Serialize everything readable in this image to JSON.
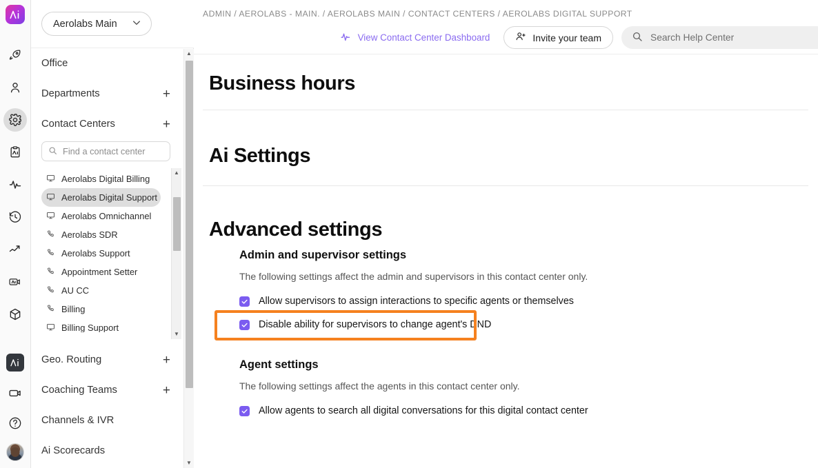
{
  "rail": {
    "logo_name": "Ai",
    "icons": [
      {
        "name": "rocket-icon",
        "label": "Getting started"
      },
      {
        "name": "user-icon",
        "label": "Users"
      },
      {
        "name": "gear-icon",
        "label": "Settings",
        "active": true
      },
      {
        "name": "clipboard-ai-icon",
        "label": "Ai forms"
      },
      {
        "name": "activity-pulse-icon",
        "label": "Live activity"
      },
      {
        "name": "history-clock-icon",
        "label": "History"
      },
      {
        "name": "trend-arrow-icon",
        "label": "Analytics"
      },
      {
        "name": "ai-camera-icon",
        "label": "Recordings"
      },
      {
        "name": "cube-icon",
        "label": "Integrations"
      }
    ],
    "bottom_icons": [
      {
        "name": "ai-app-icon",
        "label": "Ai app"
      },
      {
        "name": "video-camera-icon",
        "label": "Video"
      },
      {
        "name": "help-circle-icon",
        "label": "Help"
      },
      {
        "name": "avatar",
        "label": "Account"
      }
    ]
  },
  "sidebar": {
    "org_switcher": {
      "value": "Aerolabs Main",
      "chevron": "chevron-down-icon"
    },
    "nav": [
      {
        "label": "Office",
        "has_add": false
      },
      {
        "label": "Departments",
        "has_add": true
      },
      {
        "label": "Contact Centers",
        "has_add": true
      }
    ],
    "nav_bottom": [
      {
        "label": "Geo. Routing",
        "has_add": true
      },
      {
        "label": "Coaching Teams",
        "has_add": true
      },
      {
        "label": "Channels & IVR",
        "has_add": false
      },
      {
        "label": "Ai Scorecards",
        "has_add": false
      }
    ],
    "contact_center_search": {
      "placeholder": "Find a contact center",
      "value": ""
    },
    "contact_centers": [
      {
        "label": "Aerolabs Digital Billing",
        "icon": "monitor-icon",
        "selected": false
      },
      {
        "label": "Aerolabs Digital Support",
        "icon": "monitor-icon",
        "selected": true
      },
      {
        "label": "Aerolabs Omnichannel",
        "icon": "monitor-icon",
        "selected": false
      },
      {
        "label": "Aerolabs SDR",
        "icon": "phone-icon",
        "selected": false
      },
      {
        "label": "Aerolabs Support",
        "icon": "phone-icon",
        "selected": false
      },
      {
        "label": "Appointment Setter",
        "icon": "phone-icon",
        "selected": false
      },
      {
        "label": "AU CC",
        "icon": "phone-icon",
        "selected": false
      },
      {
        "label": "Billing",
        "icon": "phone-icon",
        "selected": false
      },
      {
        "label": "Billing Support",
        "icon": "monitor-icon",
        "selected": false
      }
    ],
    "add_symbol": "+"
  },
  "topbar": {
    "breadcrumb": "ADMIN / AEROLABS - MAIN. / AEROLABS MAIN / CONTACT CENTERS / AEROLABS DIGITAL SUPPORT",
    "dashboard_link": {
      "label": "View Contact Center Dashboard",
      "icon": "activity-pulse-icon"
    },
    "invite_button": {
      "label": "Invite your team",
      "icon": "add-user-icon"
    },
    "help_search": {
      "placeholder": "Search Help Center",
      "value": "",
      "icon": "search-icon"
    }
  },
  "main": {
    "sections": [
      {
        "title": "Business hours"
      },
      {
        "title": "Ai Settings"
      },
      {
        "title": "Advanced settings"
      }
    ],
    "admin_block": {
      "heading": "Admin and supervisor settings",
      "description": "The following settings affect the admin and supervisors in this contact center only.",
      "options": [
        {
          "label": "Allow supervisors to assign interactions to specific agents or themselves",
          "checked": true,
          "highlighted": false
        },
        {
          "label": "Disable ability for supervisors to change agent's DND",
          "checked": true,
          "highlighted": true
        }
      ]
    },
    "agent_block": {
      "heading": "Agent settings",
      "description": "The following settings affect the agents in this contact center only.",
      "options": [
        {
          "label": "Allow agents to search all digital conversations for this digital contact center",
          "checked": true,
          "highlighted": false
        }
      ]
    }
  },
  "colors": {
    "accent_purple": "#7b5cf0",
    "link_purple": "#8a6bf0",
    "highlight_orange": "#f5811f",
    "selected_gray": "#dedede"
  },
  "scrollbars": {
    "up_arrow": "▲",
    "down_arrow": "▼"
  }
}
